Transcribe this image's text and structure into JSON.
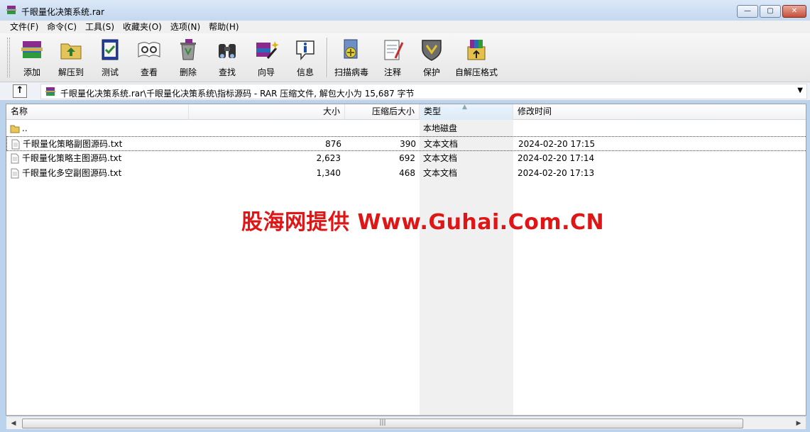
{
  "window": {
    "title": "千眼量化决策系统.rar",
    "min_glyph": "—",
    "max_glyph": "▢",
    "close_glyph": "✕"
  },
  "menu": [
    {
      "label": "文件(F)"
    },
    {
      "label": "命令(C)"
    },
    {
      "label": "工具(S)"
    },
    {
      "label": "收藏夹(O)"
    },
    {
      "label": "选项(N)"
    },
    {
      "label": "帮助(H)"
    }
  ],
  "toolbar": {
    "add": "添加",
    "extract": "解压到",
    "test": "测试",
    "view": "查看",
    "delete": "删除",
    "find": "查找",
    "wizard": "向导",
    "info": "信息",
    "scan": "扫描病毒",
    "comment": "注释",
    "protect": "保护",
    "sfx": "自解压格式"
  },
  "address": {
    "up_glyph": "↑",
    "path": "千眼量化决策系统.rar\\千眼量化决策系统\\指标源码 - RAR 压缩文件, 解包大小为 15,687 字节",
    "drop_glyph": "▼"
  },
  "columns": {
    "name": "名称",
    "size": "大小",
    "packed": "压缩后大小",
    "type": "类型",
    "modified": "修改时间"
  },
  "rows": [
    {
      "name": "..",
      "size": "",
      "packed": "",
      "type": "本地磁盘",
      "modified": ""
    },
    {
      "name": "千眼量化策略副图源码.txt",
      "size": "876",
      "packed": "390",
      "type": "文本文档",
      "modified": "2024-02-20 17:15"
    },
    {
      "name": "千眼量化策略主图源码.txt",
      "size": "2,623",
      "packed": "692",
      "type": "文本文档",
      "modified": "2024-02-20 17:14"
    },
    {
      "name": "千眼量化多空副图源码.txt",
      "size": "1,340",
      "packed": "468",
      "type": "文本文档",
      "modified": "2024-02-20 17:13"
    }
  ],
  "watermark": "股海网提供 Www.Guhai.Com.CN",
  "scrollbar": {
    "left_glyph": "◀",
    "right_glyph": "▶",
    "grip_glyph": "|||"
  },
  "colors": {
    "accent": "#e01616",
    "titlebar": "#c4d8ef",
    "selection_col": "#f0f0f0"
  },
  "icons": {
    "add": "archive-books-icon",
    "extract": "folder-extract-icon",
    "test": "clipboard-check-icon",
    "view": "open-book-glasses-icon",
    "delete": "recycle-bin-icon",
    "find": "binoculars-icon",
    "wizard": "magic-wand-icon",
    "info": "info-icon",
    "scan": "virus-scan-icon",
    "comment": "notepad-pen-icon",
    "protect": "shield-icon",
    "sfx": "self-extract-box-icon"
  }
}
